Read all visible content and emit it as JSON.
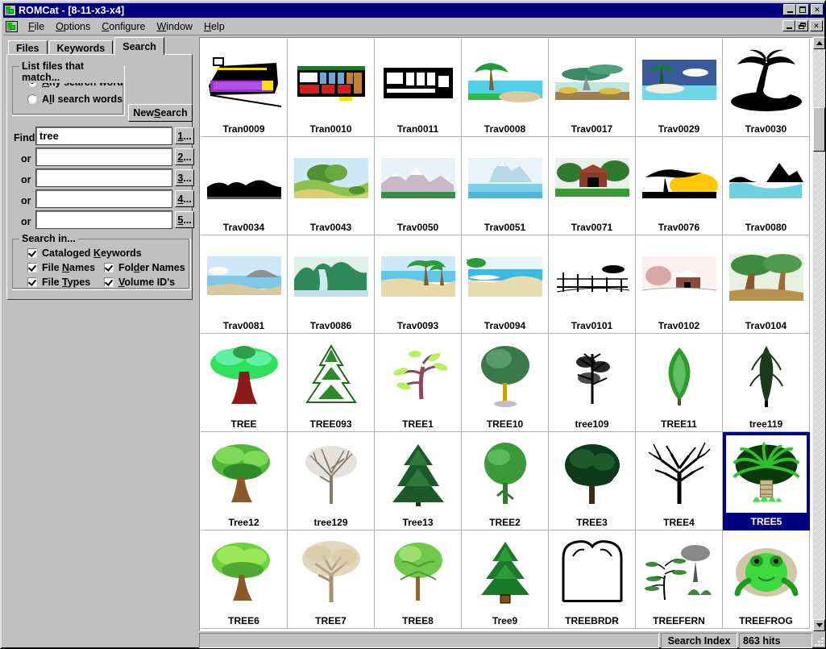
{
  "window": {
    "title": "ROMCat - [8-11-x3-x4]",
    "icon": "app-cube-icon",
    "controls": {
      "minimize": "_",
      "maximize": "□",
      "close": "✕"
    },
    "mdi_controls": {
      "minimize": "_",
      "restore": "❐",
      "close": "✕"
    }
  },
  "menu": [
    {
      "label": "File",
      "accel": "F"
    },
    {
      "label": "Options",
      "accel": "O"
    },
    {
      "label": "Configure",
      "accel": "C"
    },
    {
      "label": "Window",
      "accel": "W"
    },
    {
      "label": "Help",
      "accel": "H"
    }
  ],
  "tabs": [
    {
      "label": "Files",
      "active": false
    },
    {
      "label": "Keywords",
      "active": false
    },
    {
      "label": "Search",
      "active": true
    }
  ],
  "match_group": {
    "title": "List files that match...",
    "options": [
      {
        "label": "Any search word",
        "accel": "A",
        "selected": true
      },
      {
        "label": "All search words",
        "accel": "l",
        "selected": false
      }
    ]
  },
  "new_search_button": {
    "label": "New Search",
    "accel": "S"
  },
  "find": {
    "label": "Find",
    "or_label": "or",
    "rows": [
      {
        "value": "tree",
        "button": "1...",
        "accel": "1"
      },
      {
        "value": "",
        "button": "2...",
        "accel": "2"
      },
      {
        "value": "",
        "button": "3...",
        "accel": "3"
      },
      {
        "value": "",
        "button": "4...",
        "accel": "4"
      },
      {
        "value": "",
        "button": "5...",
        "accel": "5"
      }
    ]
  },
  "search_in": {
    "title": "Search in...",
    "items": [
      {
        "label": "Cataloged Keywords",
        "accel": "K",
        "checked": true
      },
      {
        "label": "File Names",
        "accel": "N",
        "checked": true
      },
      {
        "label": "Folder Names",
        "accel": "d",
        "checked": true
      },
      {
        "label": "File Types",
        "accel": "T",
        "checked": true
      },
      {
        "label": "Volume ID's",
        "accel": "V",
        "checked": true
      }
    ]
  },
  "status": {
    "left": "",
    "index_label": "Search Index",
    "hits": "863 hits"
  },
  "scrollbar": {
    "up": "scroll-up-arrow",
    "down": "scroll-down-arrow"
  },
  "colors": {
    "titlebar": "#000080",
    "face": "#c0c0c0",
    "selection": "#000080",
    "selection_text": "#ffffff"
  },
  "thumbnails": [
    {
      "name": "Tran0009",
      "art": "tram",
      "selected": false
    },
    {
      "name": "Tran0010",
      "art": "trolley",
      "selected": false
    },
    {
      "name": "Tran0011",
      "art": "streetcar",
      "selected": false
    },
    {
      "name": "Trav0008",
      "art": "palm-lagoon",
      "selected": false
    },
    {
      "name": "Trav0017",
      "art": "cypress-shore",
      "selected": false
    },
    {
      "name": "Trav0029",
      "art": "island-night",
      "selected": false
    },
    {
      "name": "Trav0030",
      "art": "palm-silhouette",
      "selected": false
    },
    {
      "name": "Trav0034",
      "art": "dark-horizon",
      "selected": false
    },
    {
      "name": "Trav0043",
      "art": "green-hills",
      "selected": false
    },
    {
      "name": "Trav0050",
      "art": "mountains",
      "selected": false
    },
    {
      "name": "Trav0051",
      "art": "snow-peak",
      "selected": false
    },
    {
      "name": "Trav0071",
      "art": "covered-bridge",
      "selected": false
    },
    {
      "name": "Trav0076",
      "art": "acacia-sunset",
      "selected": false
    },
    {
      "name": "Trav0080",
      "art": "rocky-coast",
      "selected": false
    },
    {
      "name": "Trav0081",
      "art": "blue-cove",
      "selected": false
    },
    {
      "name": "Trav0086",
      "art": "waterfall",
      "selected": false
    },
    {
      "name": "Trav0093",
      "art": "beach-palms",
      "selected": false
    },
    {
      "name": "Trav0094",
      "art": "beach-wave",
      "selected": false
    },
    {
      "name": "Trav0101",
      "art": "fence-field",
      "selected": false
    },
    {
      "name": "Trav0102",
      "art": "winter-cabin",
      "selected": false
    },
    {
      "name": "Trav0104",
      "art": "forest-path",
      "selected": false
    },
    {
      "name": "TREE",
      "art": "broadleaf-red-trunk",
      "selected": false
    },
    {
      "name": "TREE093",
      "art": "snowy-fir",
      "selected": false
    },
    {
      "name": "TREE1",
      "art": "sparse-sapling",
      "selected": false
    },
    {
      "name": "TREE10",
      "art": "round-canopy",
      "selected": false
    },
    {
      "name": "tree109",
      "art": "bare-tall-tree",
      "selected": false
    },
    {
      "name": "TREE11",
      "art": "slim-poplar",
      "selected": false
    },
    {
      "name": "tree119",
      "art": "conifer-dark",
      "selected": false
    },
    {
      "name": "Tree12",
      "art": "oak-green",
      "selected": false
    },
    {
      "name": "tree129",
      "art": "bare-branches",
      "selected": false
    },
    {
      "name": "Tree13",
      "art": "dark-spruce",
      "selected": false
    },
    {
      "name": "TREE2",
      "art": "lollipop-tree",
      "selected": false
    },
    {
      "name": "TREE3",
      "art": "dense-dark-tree",
      "selected": false
    },
    {
      "name": "TREE4",
      "art": "winter-oak",
      "selected": false
    },
    {
      "name": "TREE5",
      "art": "palm-cycad",
      "selected": true
    },
    {
      "name": "TREE6",
      "art": "bright-green-tree",
      "selected": false
    },
    {
      "name": "TREE7",
      "art": "tan-autumn-tree",
      "selected": false
    },
    {
      "name": "TREE8",
      "art": "young-green-tree",
      "selected": false
    },
    {
      "name": "Tree9",
      "art": "christmas-fir",
      "selected": false
    },
    {
      "name": "TREEBRDR",
      "art": "tree-border-frame",
      "selected": false
    },
    {
      "name": "TREEFERN",
      "art": "fern-plants",
      "selected": false
    },
    {
      "name": "TREEFROG",
      "art": "tree-frog",
      "selected": false
    }
  ]
}
